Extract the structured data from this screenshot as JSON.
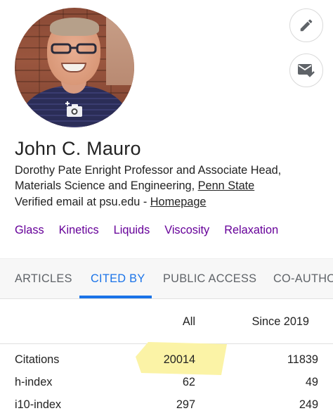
{
  "profile": {
    "name": "John C. Mauro",
    "affiliation_text": "Dorothy Pate Enright Professor and Associate Head, Materials Science and Engineering, ",
    "affiliation_link": "Penn State",
    "verified_text": "Verified email at psu.edu - ",
    "homepage_link": "Homepage",
    "avatar_icon": "profile-photo",
    "camera_icon": "add-photo-camera-icon"
  },
  "actions": {
    "edit_icon": "pencil-icon",
    "email_icon": "email-check-icon"
  },
  "interests": [
    "Glass",
    "Kinetics",
    "Liquids",
    "Viscosity",
    "Relaxation"
  ],
  "tabs": [
    "ARTICLES",
    "CITED BY",
    "PUBLIC ACCESS",
    "CO-AUTHO"
  ],
  "active_tab": "CITED BY",
  "citations": {
    "header_all": "All",
    "header_since": "Since 2019",
    "rows": [
      {
        "label": "Citations",
        "all": "20014",
        "since": "11839"
      },
      {
        "label": "h-index",
        "all": "62",
        "since": "49"
      },
      {
        "label": "i10-index",
        "all": "297",
        "since": "249"
      }
    ]
  },
  "colors": {
    "link_purple": "#660099",
    "accent_blue": "#1a73e8",
    "highlight_yellow": "#fbf3a6"
  }
}
